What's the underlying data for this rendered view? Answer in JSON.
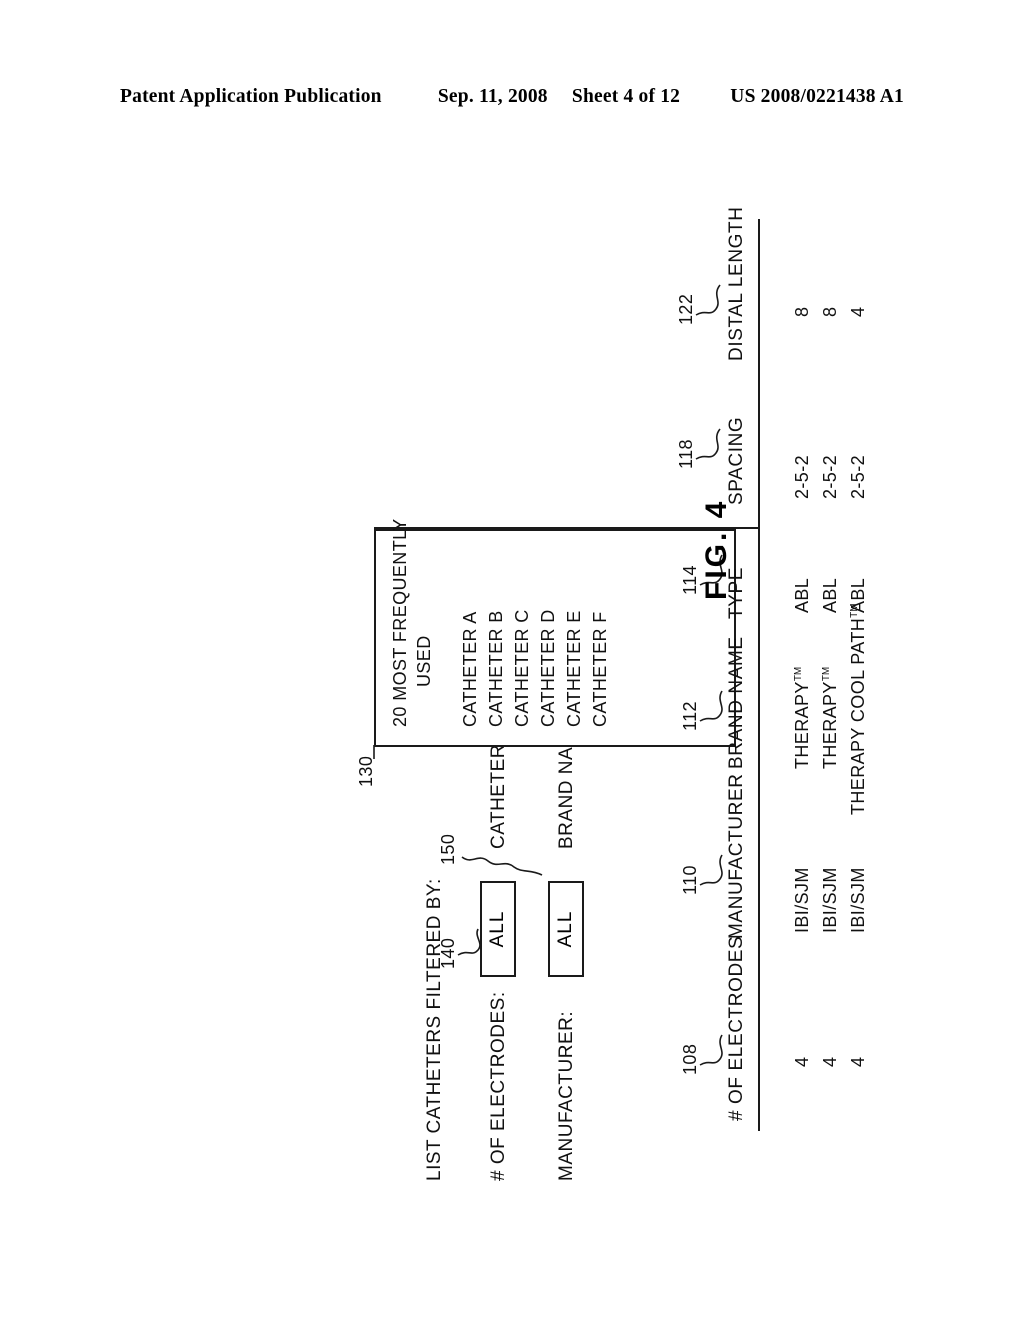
{
  "patent_header": {
    "publication": "Patent Application Publication",
    "date": "Sep. 11, 2008",
    "sheet": "Sheet 4 of 12",
    "number": "US 2008/0221438 A1"
  },
  "figure": {
    "label": "FIG. 4"
  },
  "filter_panel": {
    "title": "LIST CATHETERS FILTERED BY:",
    "fields": [
      {
        "label": "# OF ELECTRODES:",
        "value": "ALL",
        "ref": "140"
      },
      {
        "label": "MANUFACTURER:",
        "value": "ALL",
        "ref": "150"
      },
      {
        "label": "CATHETER TYPE:",
        "value": "",
        "ref": ""
      }
    ],
    "brand_name_label": "BRAND NAME:"
  },
  "list_box": {
    "ref": "130",
    "header_line1": "20 MOST FREQUENTLY",
    "header_line2": "USED",
    "items": [
      "CATHETER A",
      "CATHETER B",
      "CATHETER C",
      "CATHETER D",
      "CATHETER E",
      "CATHETER F"
    ]
  },
  "table": {
    "columns": [
      {
        "header": "# OF ELECTRODES",
        "ref": "108"
      },
      {
        "header": "MANUFACTURER",
        "ref": "110"
      },
      {
        "header": "BRAND NAME",
        "ref": "112"
      },
      {
        "header": "TYPE",
        "ref": "114"
      },
      {
        "header": "SPACING",
        "ref": "118"
      },
      {
        "header": "DISTAL LENGTH",
        "ref": "122"
      }
    ],
    "rows": [
      {
        "electrodes": "4",
        "manufacturer": "IBI/SJM",
        "brand_name": "THERAPY",
        "brand_name_tm": "TM",
        "type": "ABL",
        "spacing": "2-5-2",
        "distal_length": "8"
      },
      {
        "electrodes": "4",
        "manufacturer": "IBI/SJM",
        "brand_name": "THERAPY",
        "brand_name_tm": "TM",
        "type": "ABL",
        "spacing": "2-5-2",
        "distal_length": "8"
      },
      {
        "electrodes": "4",
        "manufacturer": "IBI/SJM",
        "brand_name": "THERAPY COOL PATH",
        "brand_name_tm": "TM",
        "type": "ABL",
        "spacing": "2-5-2",
        "distal_length": "4"
      }
    ]
  }
}
